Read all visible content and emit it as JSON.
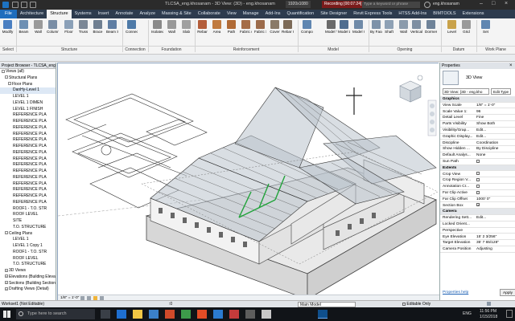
{
  "title_bar": {
    "document": "TLCSA_eng.khosanam - 3D View: (3D) - eng.khosanam",
    "display": "1920x1080",
    "recording": "Recording [00:07:24]",
    "search_placeholder": "Type a keyword or phrase",
    "user": "eng.khosanam"
  },
  "menu_tabs": [
    {
      "label": "File",
      "name": "file"
    },
    {
      "label": "Architecture",
      "name": "architecture"
    },
    {
      "label": "Structure",
      "name": "structure"
    },
    {
      "label": "Systems",
      "name": "systems"
    },
    {
      "label": "Insert",
      "name": "insert"
    },
    {
      "label": "Annotate",
      "name": "annotate"
    },
    {
      "label": "Analyze",
      "name": "analyze"
    },
    {
      "label": "Massing & Site",
      "name": "massing-site"
    },
    {
      "label": "Collaborate",
      "name": "collaborate"
    },
    {
      "label": "View",
      "name": "view"
    },
    {
      "label": "Manage",
      "name": "manage"
    },
    {
      "label": "Add-Ins",
      "name": "add-ins"
    },
    {
      "label": "Quantification",
      "name": "quantification"
    },
    {
      "label": "Site Designer",
      "name": "site-designer"
    },
    {
      "label": "Revit Express Tools",
      "name": "revit-express-tools"
    },
    {
      "label": "HTSS Add-Ins",
      "name": "htss-add-ins"
    },
    {
      "label": "BIMTOOLS",
      "name": "bimtools"
    },
    {
      "label": "Extensions",
      "name": "extensions"
    }
  ],
  "ribbon": {
    "tools": [
      {
        "label": "Modify",
        "icon": "cursor-icon",
        "color": "#4a7fc1"
      },
      {
        "label": "Beam",
        "icon": "beam-icon",
        "color": "#6d8fb3"
      },
      {
        "label": "Wall",
        "icon": "wall-icon",
        "color": "#9a9a9a"
      },
      {
        "label": "Column",
        "icon": "column-icon",
        "color": "#7a8ea6"
      },
      {
        "label": "Floor",
        "icon": "floor-icon",
        "color": "#8aa0b8"
      },
      {
        "label": "Truss",
        "icon": "truss-icon",
        "color": "#7b8796"
      },
      {
        "label": "Brace",
        "icon": "brace-icon",
        "color": "#6f7f91"
      },
      {
        "label": "Beam System",
        "icon": "beam-system-icon",
        "color": "#5f7ea3"
      },
      {
        "label": "Connection",
        "icon": "connection-icon",
        "color": "#4e7aa8"
      },
      {
        "label": "Isolated",
        "icon": "isolated-foundation-icon",
        "color": "#8a8a8a"
      },
      {
        "label": "Wall",
        "icon": "wall-foundation-icon",
        "color": "#999"
      },
      {
        "label": "Slab",
        "icon": "slab-icon",
        "color": "#a0a0a0"
      },
      {
        "label": "Rebar",
        "icon": "rebar-icon",
        "color": "#b45d3a"
      },
      {
        "label": "Area",
        "icon": "area-rebar-icon",
        "color": "#c07a3f"
      },
      {
        "label": "Path",
        "icon": "path-rebar-icon",
        "color": "#b06a35"
      },
      {
        "label": "Fabric Area",
        "icon": "fabric-area-icon",
        "color": "#a56d48"
      },
      {
        "label": "Fabric Sheet",
        "icon": "fabric-sheet-icon",
        "color": "#9c6b4b"
      },
      {
        "label": "Cover",
        "icon": "cover-icon",
        "color": "#8a7a68"
      },
      {
        "label": "Rebar Coupler",
        "icon": "rebar-coupler-icon",
        "color": "#7c6a57"
      },
      {
        "label": "Component",
        "icon": "component-icon",
        "color": "#5f86b1"
      },
      {
        "label": "Model Text",
        "icon": "model-text-icon",
        "color": "#6a6a6a"
      },
      {
        "label": "Model Line",
        "icon": "model-line-icon",
        "color": "#4f6d8f"
      },
      {
        "label": "Model Group",
        "icon": "model-group-icon",
        "color": "#6f8aa8"
      },
      {
        "label": "By Face",
        "icon": "by-face-icon",
        "color": "#7d92a9"
      },
      {
        "label": "Shaft",
        "icon": "shaft-icon",
        "color": "#8ea1b5"
      },
      {
        "label": "Wall",
        "icon": "wall-opening-icon",
        "color": "#8a9aab"
      },
      {
        "label": "Vertical",
        "icon": "vertical-opening-icon",
        "color": "#7e8fa2"
      },
      {
        "label": "Dormer",
        "icon": "dormer-icon",
        "color": "#6f8399"
      },
      {
        "label": "Level",
        "icon": "level-icon",
        "color": "#c9a24a"
      },
      {
        "label": "Grid",
        "icon": "grid-icon",
        "color": "#9a9a9a"
      },
      {
        "label": "Set",
        "icon": "set-icon",
        "color": "#5f86b1"
      }
    ],
    "groups": [
      {
        "label": "Select"
      },
      {
        "label": "Structure"
      },
      {
        "label": "Connection"
      },
      {
        "label": "Foundation"
      },
      {
        "label": "Reinforcement"
      },
      {
        "label": "Model"
      },
      {
        "label": "Opening"
      },
      {
        "label": "Datum"
      },
      {
        "label": "Work Plane"
      }
    ]
  },
  "project_browser": {
    "title": "Project Browser - TLCSA_eng.khosanam.rvt",
    "items": [
      {
        "label": "Views (all)",
        "toggle": "-"
      },
      {
        "label": "Structural Plans",
        "toggle": "-"
      },
      {
        "label": "Floor Plans",
        "toggle": "-"
      },
      {
        "label": "DanHy-Level 1",
        "toggle": ""
      },
      {
        "label": "LEVEL 1",
        "toggle": ""
      },
      {
        "label": "LEVEL 1 DIMEN",
        "toggle": ""
      },
      {
        "label": "LEVEL 1 FINISH",
        "toggle": ""
      },
      {
        "label": "REFERENCE PLA",
        "toggle": ""
      },
      {
        "label": "REFERENCE PLA",
        "toggle": ""
      },
      {
        "label": "REFERENCE PLA",
        "toggle": ""
      },
      {
        "label": "REFERENCE PLA",
        "toggle": ""
      },
      {
        "label": "REFERENCE PLA",
        "toggle": ""
      },
      {
        "label": "REFERENCE PLA",
        "toggle": ""
      },
      {
        "label": "REFERENCE PLA",
        "toggle": ""
      },
      {
        "label": "REFERENCE PLA",
        "toggle": ""
      },
      {
        "label": "REFERENCE PLA",
        "toggle": ""
      },
      {
        "label": "REFERENCE PLA",
        "toggle": ""
      },
      {
        "label": "REFERENCE PLA",
        "toggle": ""
      },
      {
        "label": "REFERENCE PLA",
        "toggle": ""
      },
      {
        "label": "REFERENCE PLA",
        "toggle": ""
      },
      {
        "label": "REFERENCE PLA",
        "toggle": ""
      },
      {
        "label": "REFERENCE PLA",
        "toggle": ""
      },
      {
        "label": "ROOF1 - T.O. STR",
        "toggle": ""
      },
      {
        "label": "ROOF LEVEL",
        "toggle": ""
      },
      {
        "label": "SITE",
        "toggle": ""
      },
      {
        "label": "T.O. STRUCTURE",
        "toggle": ""
      },
      {
        "label": "Ceiling Plans",
        "toggle": "-"
      },
      {
        "label": "LEVEL 1",
        "toggle": ""
      },
      {
        "label": "LEVEL 1 Copy 1",
        "toggle": ""
      },
      {
        "label": "ROOF1 - T.O. STR",
        "toggle": ""
      },
      {
        "label": "ROOF LEVEL",
        "toggle": ""
      },
      {
        "label": "T.O. STRUCTURE",
        "toggle": ""
      },
      {
        "label": "3D Views",
        "toggle": "+"
      },
      {
        "label": "Elevations (Building Elevation)",
        "toggle": "+"
      },
      {
        "label": "Sections (Building Section)",
        "toggle": "+"
      },
      {
        "label": "Drafting Views (Detail)",
        "toggle": "+"
      }
    ]
  },
  "viewport": {
    "title": "3D View: (3D)",
    "scale_label": "1/8\" = 1'-0\"",
    "viewcube_label": "FRONT"
  },
  "properties": {
    "title": "Properties",
    "type_name": "3D View",
    "selector": "3D View: {3D - eng.kho",
    "edit_type": "Edit Type",
    "rows": [
      {
        "key": "Graphics",
        "section": true
      },
      {
        "key": "View Scale",
        "value": "1/8\" = 1'-0\""
      },
      {
        "key": "Scale Value 1:",
        "value": "96"
      },
      {
        "key": "Detail Level",
        "value": "Fine"
      },
      {
        "key": "Parts Visibility",
        "value": "Show Both"
      },
      {
        "key": "Visibility/Grap...",
        "value": "Edit..."
      },
      {
        "key": "Graphic Display...",
        "value": "Edit..."
      },
      {
        "key": "Discipline",
        "value": "Coordination"
      },
      {
        "key": "Show Hidden ...",
        "value": "By Discipline"
      },
      {
        "key": "Default Analys...",
        "value": "None"
      },
      {
        "key": "Sun Path",
        "value": "",
        "checkbox": true
      },
      {
        "key": "Extents",
        "section": true
      },
      {
        "key": "Crop View",
        "value": "",
        "checkbox": true
      },
      {
        "key": "Crop Region V...",
        "value": "",
        "checkbox": true
      },
      {
        "key": "Annotation Cr...",
        "value": "",
        "checkbox": true
      },
      {
        "key": "Far Clip Active",
        "value": "",
        "checkbox": true
      },
      {
        "key": "Far Clip Offset",
        "value": "1000' 0\""
      },
      {
        "key": "Section Box",
        "value": "",
        "checkbox": true,
        "checked": true
      },
      {
        "key": "Camera",
        "section": true
      },
      {
        "key": "Rendering Sett...",
        "value": "Edit..."
      },
      {
        "key": "Locked Orient...",
        "value": ""
      },
      {
        "key": "Perspective",
        "value": ""
      },
      {
        "key": "Eye Elevation",
        "value": "15' 2 3/256\""
      },
      {
        "key": "Target Elevation",
        "value": "35' 7 65/128\""
      },
      {
        "key": "Camera Position",
        "value": "Adjusting"
      }
    ],
    "help_link": "Properties help",
    "apply_label": "Apply"
  },
  "status_bar": {
    "workset": "Workset1 (Not Editable)",
    "main_model": "Main Model",
    "editable_only": "Editable Only",
    "zero": ":0"
  },
  "taskbar": {
    "search_placeholder": "Type here to search",
    "time": "11:56 PM",
    "date": "1/15/2018",
    "language": "ENG",
    "background": "#111418"
  }
}
